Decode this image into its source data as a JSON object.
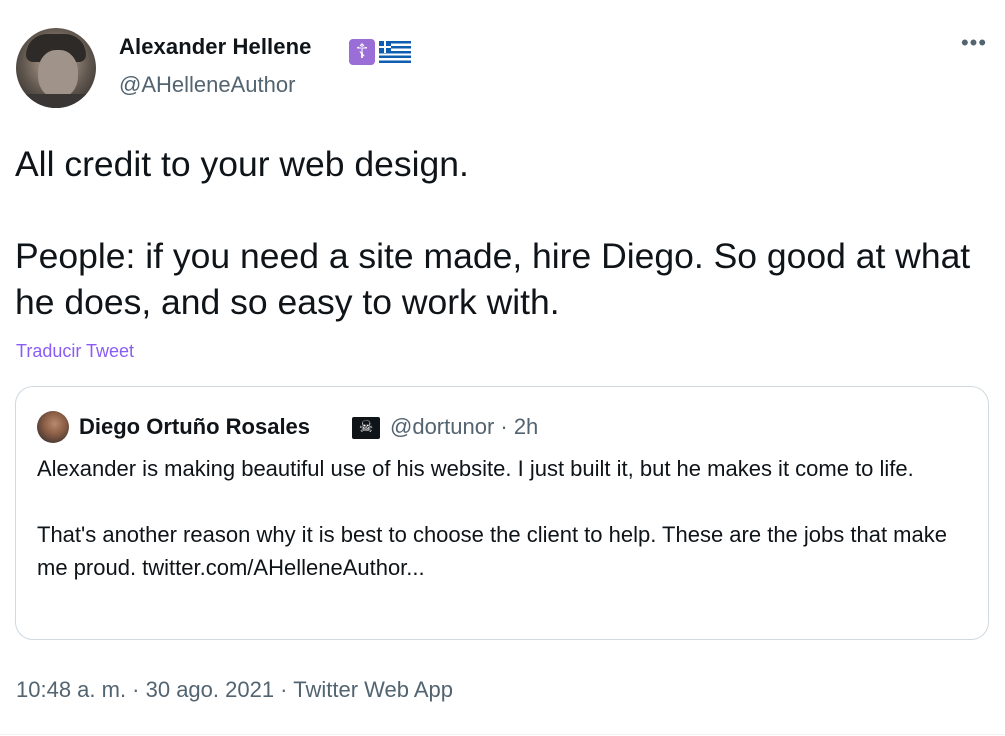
{
  "author": {
    "name": "Alexander Hellene",
    "handle": "@AHelleneAuthor",
    "badge_cross": "☦",
    "icons": [
      "orthodox-cross-icon",
      "greek-flag-icon"
    ]
  },
  "more_label": "•••",
  "tweet": {
    "line1": "All credit to your web design.",
    "line2": "People: if you need a site made, hire Diego. So good at what he does, and so easy to work with."
  },
  "translate_label": "Traducir Tweet",
  "quoted": {
    "name": "Diego Ortuño Rosales",
    "badge": "☠",
    "meta": "@dortunor · 2h",
    "text1": "Alexander is making beautiful use of his website. I just built it, but he makes it come to life.",
    "text2": "That's another reason why it is best to choose the client to help. These are the jobs that make me proud. twitter.com/AHelleneAuthor..."
  },
  "footer": {
    "time_date": "10:48 a. m. · 30 ago. 2021 · ",
    "app": "Twitter Web App"
  },
  "colors": {
    "text": "#0f1419",
    "muted": "#536471",
    "translate": "#8a5cf5",
    "border": "#cfd9de"
  }
}
